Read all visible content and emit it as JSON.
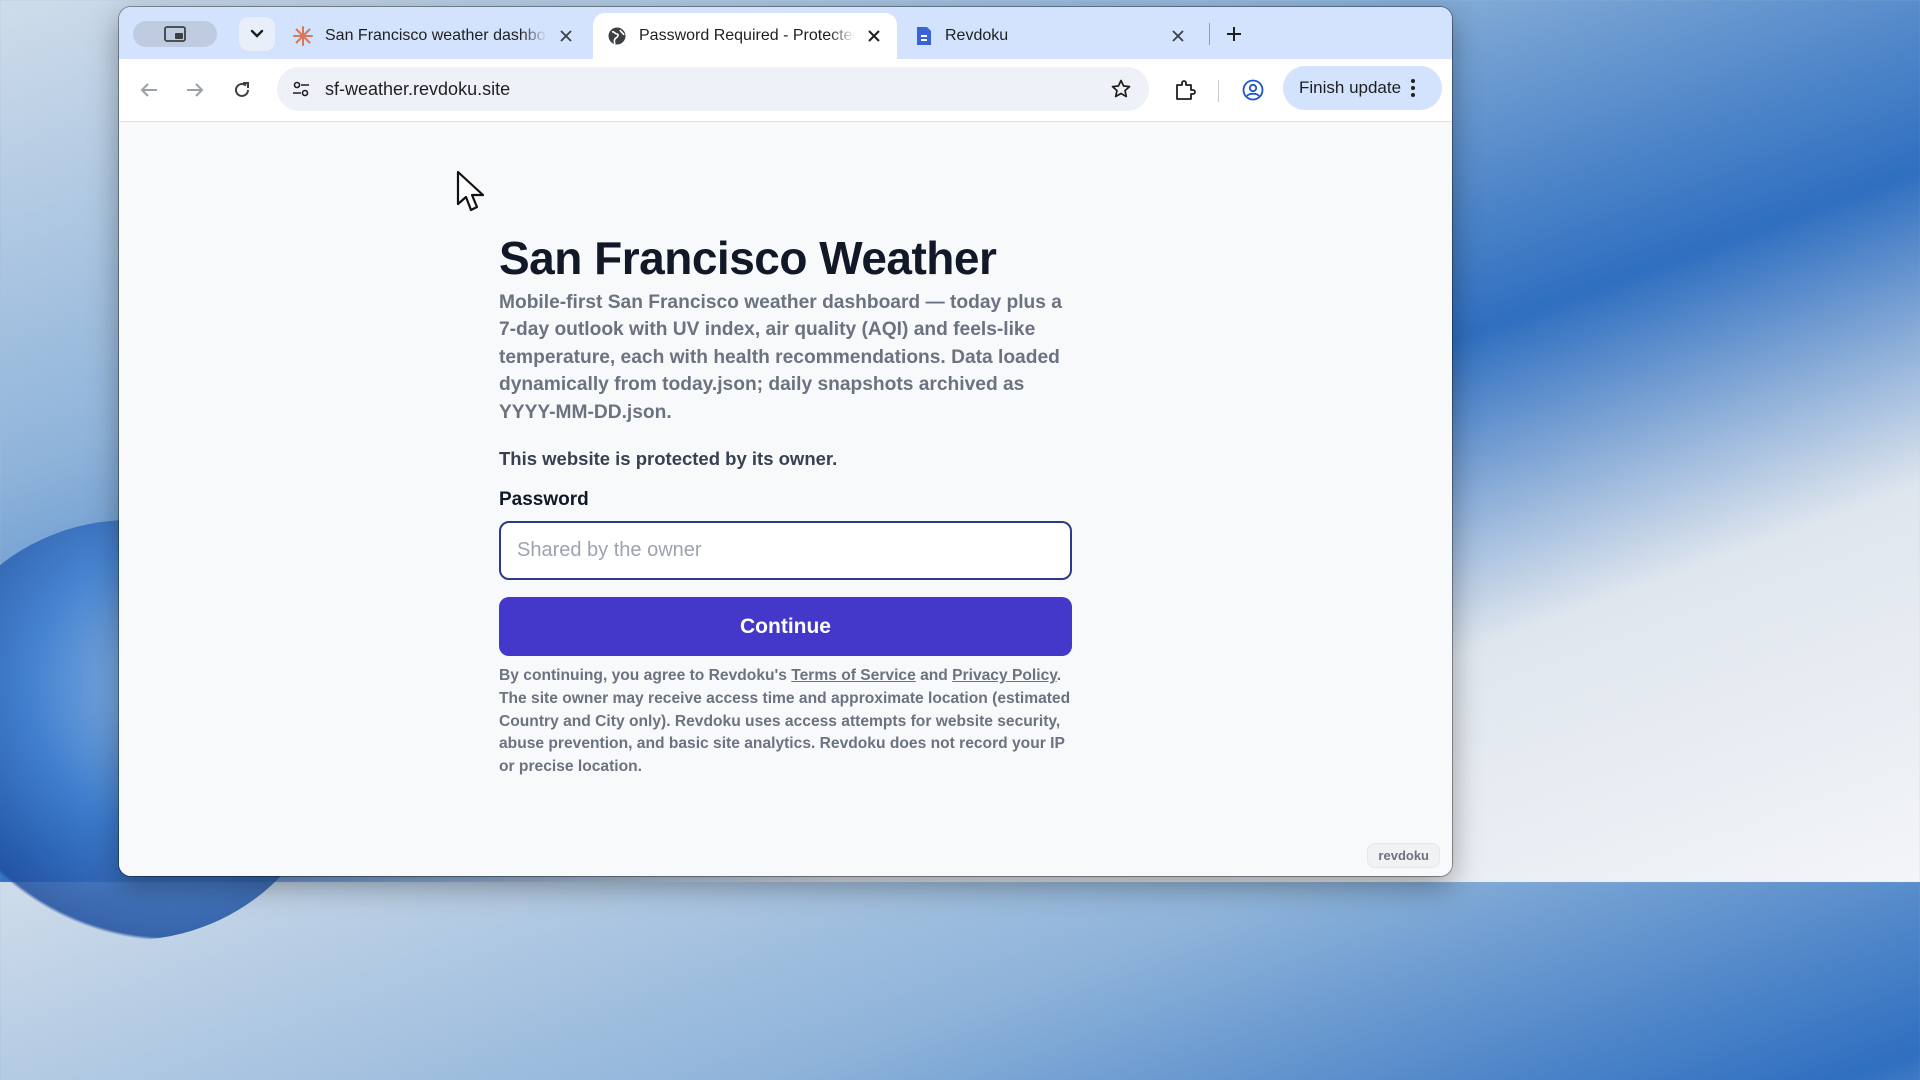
{
  "tabs": [
    {
      "title": "San Francisco weather dashboard",
      "icon": "sparkle-icon",
      "active": false
    },
    {
      "title": "Password Required - Protected",
      "icon": "globe-icon",
      "active": true
    },
    {
      "title": "Revdoku",
      "icon": "document-icon",
      "active": false
    }
  ],
  "toolbar": {
    "url": "sf-weather.revdoku.site",
    "finish_update_label": "Finish update"
  },
  "page": {
    "title": "San Francisco Weather",
    "description": "Mobile-first San Francisco weather dashboard — today plus a 7-day outlook with UV index, air quality (AQI) and feels-like temperature, each with health recommendations. Data loaded dynamically from today.json; daily snapshots archived as YYYY-MM-DD.json.",
    "protected_notice": "This website is protected by its owner.",
    "password_label": "Password",
    "password_placeholder": "Shared by the owner",
    "password_value": "",
    "continue_label": "Continue",
    "legal": {
      "prefix": "By continuing, you agree to Revdoku's ",
      "terms_link": "Terms of Service",
      "and": " and ",
      "privacy_link": "Privacy Policy",
      "suffix": ". The site owner may receive access time and approximate location (estimated Country and City only). Revdoku uses access attempts for website security, abuse prevention, and basic site analytics. Revdoku does not record your IP or precise location."
    },
    "badge": "revdoku"
  },
  "colors": {
    "accent": "#4338ca",
    "tabstrip": "#d3e3fd",
    "input_border": "#2b3a8a"
  }
}
